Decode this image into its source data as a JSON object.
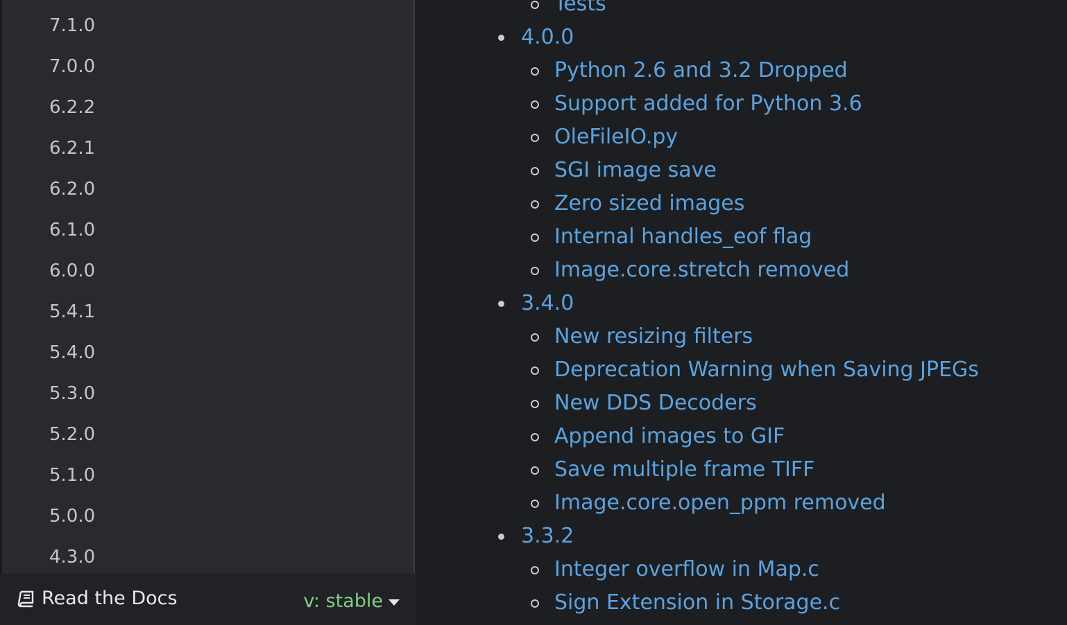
{
  "sidebar": {
    "versions": [
      "7.1.0",
      "7.0.0",
      "6.2.2",
      "6.2.1",
      "6.2.0",
      "6.1.0",
      "6.0.0",
      "5.4.1",
      "5.4.0",
      "5.3.0",
      "5.2.0",
      "5.1.0",
      "5.0.0",
      "4.3.0"
    ]
  },
  "rtd": {
    "brand_label": "Read the Docs",
    "version_label": "v: stable",
    "icons": {
      "brand": "book-icon",
      "dropdown": "caret-down-icon"
    },
    "colors": {
      "version": "#7fd082",
      "bar_bg": "#212225"
    }
  },
  "content": {
    "top_partial": "Tests",
    "releases": [
      {
        "version": "4.0.0",
        "items": [
          "Python 2.6 and 3.2 Dropped",
          "Support added for Python 3.6",
          "OleFileIO.py",
          "SGI image save",
          "Zero sized images",
          "Internal handles_eof flag",
          "Image.core.stretch removed"
        ]
      },
      {
        "version": "3.4.0",
        "items": [
          "New resizing filters",
          "Deprecation Warning when Saving JPEGs",
          "New DDS Decoders",
          "Append images to GIF",
          "Save multiple frame TIFF",
          "Image.core.open_ppm removed"
        ]
      },
      {
        "version": "3.3.2",
        "items": [
          "Integer overflow in Map.c",
          "Sign Extension in Storage.c"
        ]
      }
    ],
    "colors": {
      "link": "#5aa3e0",
      "bullet": "#c9cbcf"
    }
  }
}
